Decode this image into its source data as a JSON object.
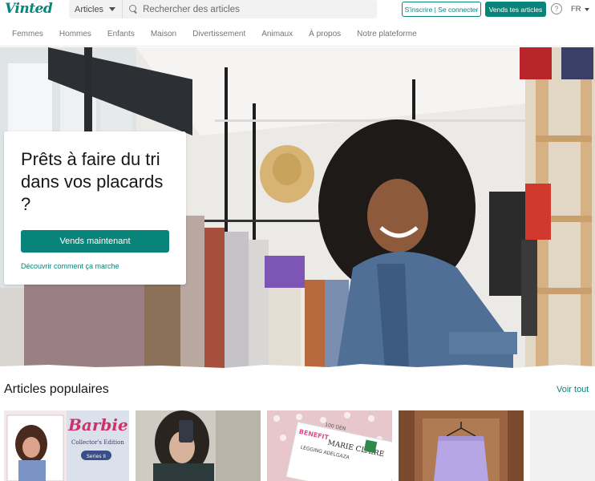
{
  "brand": {
    "logo": "Vinted",
    "accent": "#09847a"
  },
  "header": {
    "search_category": "Articles",
    "search_placeholder": "Rechercher des articles",
    "login_label": "S'inscrire | Se connecter",
    "sell_label": "Vends tes articles",
    "help_symbol": "?",
    "language": "FR"
  },
  "nav": {
    "items": [
      "Femmes",
      "Hommes",
      "Enfants",
      "Maison",
      "Divertissement",
      "Animaux",
      "À propos",
      "Notre plateforme"
    ]
  },
  "hero": {
    "headline": "Prêts à faire du tri dans vos placards ?",
    "cta_label": "Vends maintenant",
    "how_link": "Découvrir comment ça marche"
  },
  "popular": {
    "title": "Articles populaires",
    "see_all": "Voir tout",
    "items": [
      {
        "image": "barbie-doll-box",
        "text": "Barbie",
        "subtext": "Collector's Edition",
        "series": "Series II"
      },
      {
        "image": "woman-mirror-selfie"
      },
      {
        "image": "leggings-package",
        "brand_text": "BENEFIT",
        "text": "MARIE CLAIRE",
        "detail": "LEGGING ADELGAZA",
        "den": "100 DEN"
      },
      {
        "image": "lavender-trousers-on-hanger"
      },
      {
        "image": "blank-card"
      }
    ]
  }
}
